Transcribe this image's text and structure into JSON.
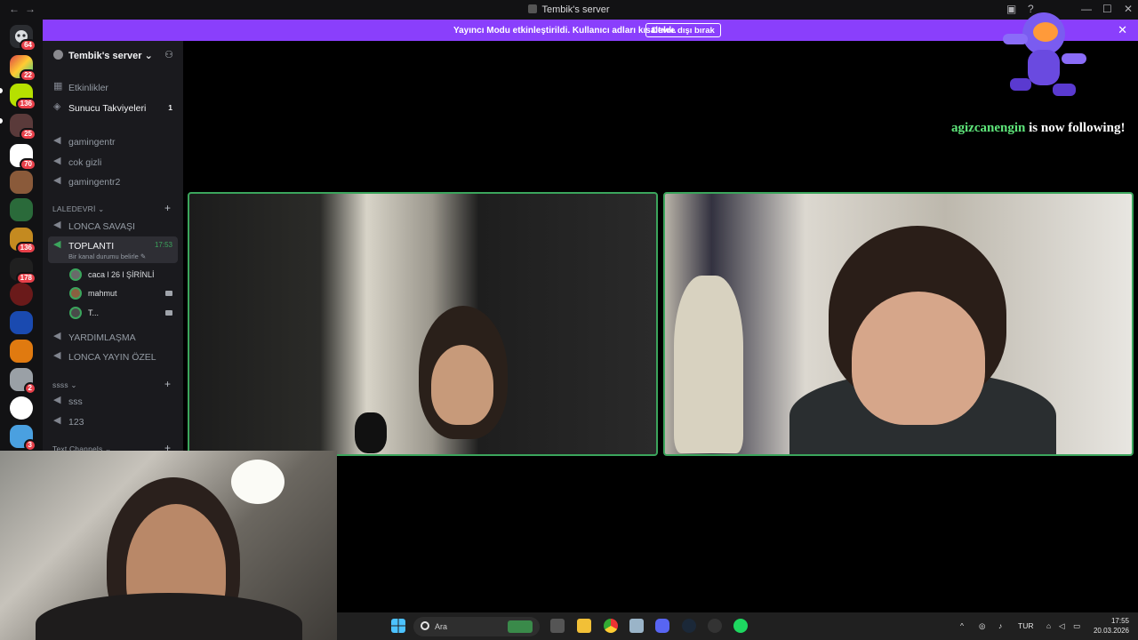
{
  "window": {
    "title": "Tembik's server",
    "back_icon": "←",
    "forward_icon": "→",
    "controls": {
      "minimize": "—",
      "maximize": "☐",
      "close": "✕"
    }
  },
  "banner": {
    "message": "Yayıncı Modu etkinleştirildi. Kullanıcı adları kısaltıldı.",
    "button": "Devre dışı bırak",
    "close": "✕"
  },
  "rail": {
    "badges": [
      "64",
      "22",
      "136",
      "25",
      "70",
      "136",
      "178",
      "2",
      "3"
    ]
  },
  "sidebar": {
    "server_name": "Tembik's server ⌄",
    "top_items": [
      {
        "label": "Etkinlikler"
      },
      {
        "label": "Sunucu Takviyeleri",
        "count": "1"
      }
    ],
    "voice_channels": [
      "gamingentr",
      "cok gizli",
      "gamingentr2"
    ],
    "category1": "LALEDEVRİ ⌄",
    "lalede_channels": [
      "LONCA SAVAŞI"
    ],
    "active_channel": {
      "label": "TOPLANTI",
      "time": "17:53",
      "status": "Bir kanal durumu belirle ✎"
    },
    "users": [
      {
        "name": "caca l 26 l ŞİRİNLİ"
      },
      {
        "name": "mahmut"
      },
      {
        "name": "T..."
      }
    ],
    "more_channels": [
      "YARDIMLAŞMA",
      "LONCA YAYIN ÖZEL"
    ],
    "category2": "ssss ⌄",
    "ssss_channels": [
      "sss",
      "123"
    ],
    "category3": "Text Channels ⌄"
  },
  "overlay": {
    "username": "agizcanengin",
    "message": " is now following!"
  },
  "taskbar": {
    "search_placeholder": "Ara",
    "language": "TUR",
    "time": "17:55",
    "date": "20.03.2026"
  },
  "colors": {
    "accent": "#8a3ffc",
    "speaking": "#3ba55c",
    "badge": "#e8404a"
  }
}
